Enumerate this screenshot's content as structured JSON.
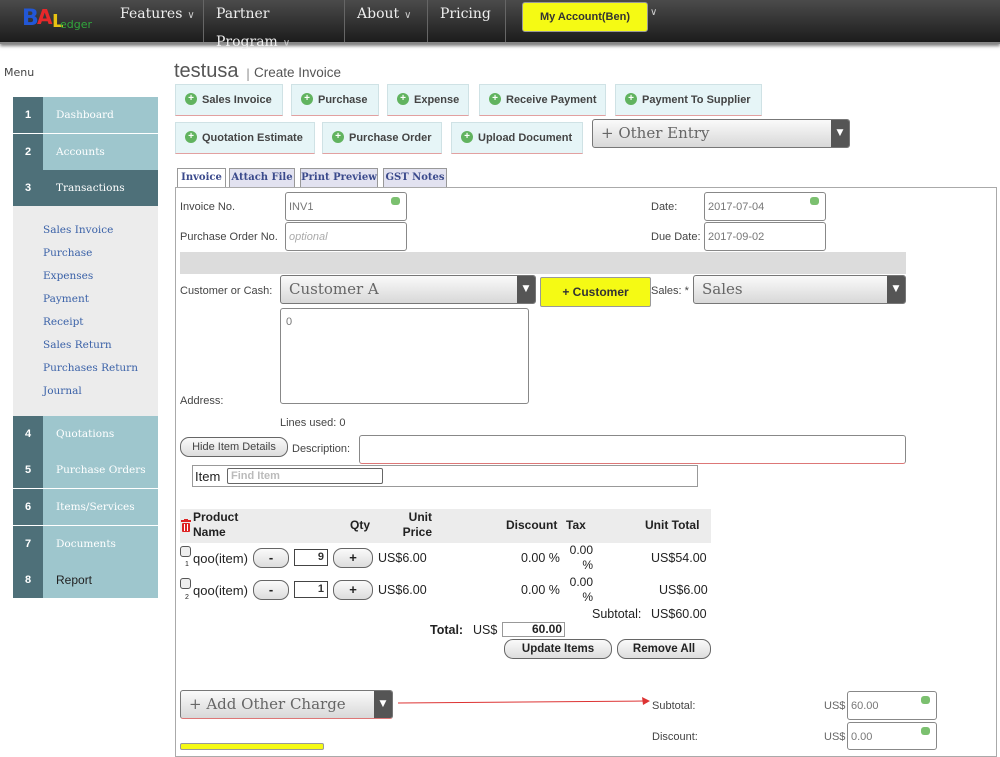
{
  "nav": {
    "logo_text": "BAL edger",
    "items": [
      {
        "label": "Features"
      },
      {
        "label": "Partner Program"
      },
      {
        "label": "About"
      },
      {
        "label": "Pricing"
      }
    ],
    "account_label": "My Account(Ben)"
  },
  "sidebar": {
    "menu_label": "Menu",
    "items": [
      {
        "num": "1",
        "label": "Dashboard"
      },
      {
        "num": "2",
        "label": "Accounts"
      },
      {
        "num": "3",
        "label": "Transactions"
      },
      {
        "num": "4",
        "label": "Quotations"
      },
      {
        "num": "5",
        "label": "Purchase Orders"
      },
      {
        "num": "6",
        "label": "Items/Services"
      },
      {
        "num": "7",
        "label": "Documents"
      },
      {
        "num": "8",
        "label": "Report"
      }
    ],
    "sub_items": [
      "Sales Invoice",
      "Purchase",
      "Expenses",
      "Payment",
      "Receipt",
      "Sales Return",
      "Purchases Return",
      "Journal"
    ]
  },
  "header": {
    "company": "testusa",
    "separator": "|",
    "page_title": "Create Invoice"
  },
  "entries": {
    "buttons": [
      "Sales Invoice",
      "Purchase",
      "Expense",
      "Receive Payment",
      "Payment To Supplier",
      "Quotation Estimate",
      "Purchase Order",
      "Upload Document"
    ],
    "other_entry": "+ Other Entry"
  },
  "tabs": [
    "Invoice",
    "Attach File",
    "Print Preview",
    "GST Notes"
  ],
  "form": {
    "invoice_no_label": "Invoice No.",
    "invoice_no": "INV1",
    "po_label": "Purchase Order No.",
    "po_placeholder": "optional",
    "date_label": "Date:",
    "date": "2017-07-04",
    "due_label": "Due Date:",
    "due_date": "2017-09-02",
    "customer_label": "Customer or Cash:",
    "customer": "Customer A",
    "add_customer": "+ Customer",
    "sales_label": "Sales: *",
    "sales": "Sales",
    "address_label": "Address:",
    "address_value": "0",
    "lines_used": "Lines used: 0",
    "hide_details": "Hide Item Details",
    "description_label": "Description:",
    "item_label": "Item",
    "item_placeholder": "Find Item"
  },
  "items_table": {
    "headers": {
      "product": "Product Name",
      "qty": "Qty",
      "unit_price": "Unit Price",
      "discount": "Discount",
      "tax": "Tax",
      "unit_total": "Unit Total"
    },
    "rows": [
      {
        "index": "1",
        "name": "qoo(item)",
        "qty": "9",
        "price": "US$6.00",
        "discount": "0.00 %",
        "tax": "0.00 %",
        "total": "US$54.00"
      },
      {
        "index": "2",
        "name": "qoo(item)",
        "qty": "1",
        "price": "US$6.00",
        "discount": "0.00 %",
        "tax": "0.00 %",
        "total": "US$6.00"
      }
    ],
    "minus": "-",
    "plus": "+",
    "subtotal_label": "Subtotal:",
    "subtotal": "US$60.00",
    "total_label": "Total:",
    "total_currency": "US$",
    "total": "60.00",
    "update_items": "Update Items",
    "remove_all": "Remove All"
  },
  "charges": {
    "add_other": "+ Add Other Charge",
    "subtotal_label": "Subtotal:",
    "subtotal_currency": "US$",
    "subtotal": "60.00",
    "discount_label": "Discount:",
    "discount_currency": "US$",
    "discount": "0.00"
  },
  "colors": {
    "accent_yellow": "#f5fa14",
    "side_dark": "#4e7079",
    "side_light": "#9ec6cd",
    "link_blue": "#3b62a8"
  }
}
